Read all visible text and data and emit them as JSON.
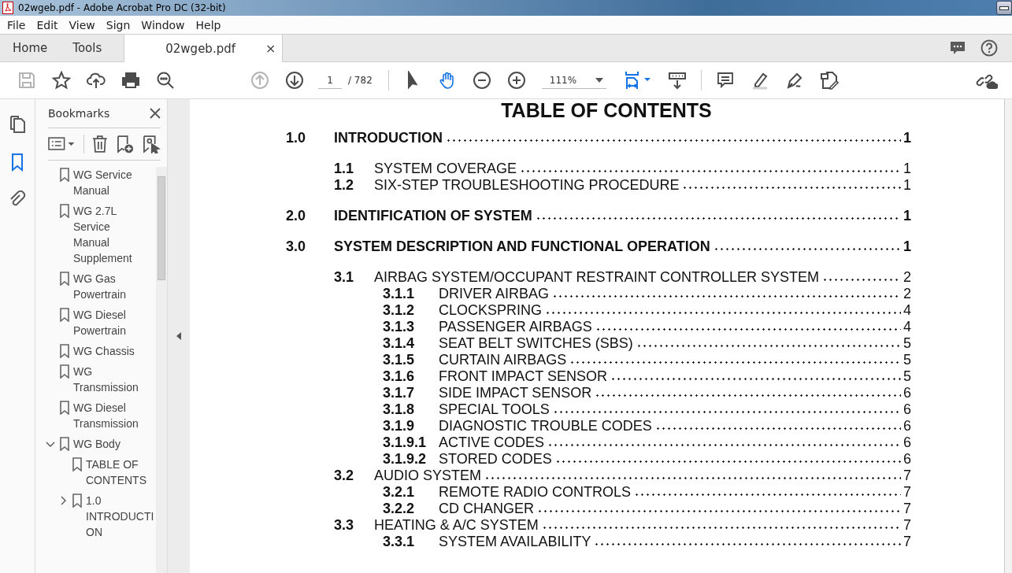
{
  "window": {
    "title": "02wgeb.pdf - Adobe Acrobat Pro DC (32-bit)"
  },
  "menu": [
    "File",
    "Edit",
    "View",
    "Sign",
    "Window",
    "Help"
  ],
  "tabs": [
    {
      "label": "Home",
      "selected": false
    },
    {
      "label": "Tools",
      "selected": false
    },
    {
      "label": "02wgeb.pdf",
      "selected": true,
      "close": "×"
    }
  ],
  "toolbar": {
    "file_tools": [
      {
        "kind": "save",
        "disabled": true,
        "selected": false
      },
      {
        "kind": "star",
        "disabled": false,
        "selected": false
      },
      {
        "kind": "upload",
        "disabled": false,
        "selected": false
      },
      {
        "kind": "print",
        "disabled": false,
        "selected": false
      },
      {
        "kind": "find",
        "disabled": false,
        "selected": false
      }
    ],
    "nav_tools": [
      {
        "kind": "prev",
        "disabled": true,
        "selected": false
      },
      {
        "kind": "next",
        "disabled": false,
        "selected": false
      }
    ],
    "page_number": "1",
    "page_total": "/ 782",
    "view_tools": [
      {
        "kind": "pointer",
        "disabled": false,
        "selected": false
      },
      {
        "kind": "hand",
        "disabled": false,
        "selected": true
      },
      {
        "kind": "zoomout",
        "disabled": false,
        "selected": false
      },
      {
        "kind": "zoomin",
        "disabled": false,
        "selected": false
      }
    ],
    "zoom": "111%",
    "layout_tools": [
      {
        "kind": "fit",
        "disabled": false,
        "selected": true
      },
      {
        "kind": "scroll",
        "disabled": false,
        "selected": false
      }
    ],
    "edit_tools": [
      {
        "kind": "comment",
        "disabled": false,
        "selected": false
      },
      {
        "kind": "highlight",
        "disabled": false,
        "selected": false
      },
      {
        "kind": "sign",
        "disabled": false,
        "selected": false
      },
      {
        "kind": "edit",
        "disabled": false,
        "selected": false
      }
    ]
  },
  "rail": [
    {
      "kind": "pages",
      "selected": false
    },
    {
      "kind": "bookmarks",
      "selected": true
    },
    {
      "kind": "attachments",
      "selected": false
    }
  ],
  "bookmarks": {
    "title": "Bookmarks",
    "items": [
      {
        "label": "WG Service Manual",
        "kind": "leaf"
      },
      {
        "label": "WG 2.7L Service Manual Supplement",
        "kind": "leaf"
      },
      {
        "label": "WG Gas Powertrain",
        "kind": "leaf"
      },
      {
        "label": "WG Diesel Powertrain",
        "kind": "leaf"
      },
      {
        "label": "WG Chassis",
        "kind": "leaf"
      },
      {
        "label": "WG Transmission",
        "kind": "leaf"
      },
      {
        "label": "WG Diesel Transmission",
        "kind": "leaf"
      },
      {
        "label": "WG Body",
        "kind": "folder",
        "expanded": true,
        "children": [
          {
            "label": "TABLE OF CONTENTS",
            "kind": "leaf"
          },
          {
            "label": "1.0 INTRODUCTION",
            "kind": "folder",
            "expanded": false
          }
        ]
      }
    ]
  },
  "document": {
    "title": "TABLE OF CONTENTS",
    "entries": [
      {
        "kind": "chapter",
        "number": "1.0",
        "title": "INTRODUCTION",
        "page": "1"
      },
      {
        "kind": "section",
        "number": "1.1",
        "title": "SYSTEM COVERAGE",
        "page": "1"
      },
      {
        "kind": "section",
        "number": "1.2",
        "title": "SIX-STEP TROUBLESHOOTING PROCEDURE",
        "page": "1"
      },
      {
        "kind": "chapter",
        "number": "2.0",
        "title": "IDENTIFICATION OF SYSTEM",
        "page": "1"
      },
      {
        "kind": "chapter",
        "number": "3.0",
        "title": "SYSTEM DESCRIPTION AND FUNCTIONAL OPERATION",
        "page": "1"
      },
      {
        "kind": "section",
        "number": "3.1",
        "title": "AIRBAG SYSTEM/OCCUPANT RESTRAINT CONTROLLER SYSTEM",
        "page": "2"
      },
      {
        "kind": "subsection",
        "number": "3.1.1",
        "title": "DRIVER AIRBAG",
        "page": "2"
      },
      {
        "kind": "subsection",
        "number": "3.1.2",
        "title": "CLOCKSPRING",
        "page": "4"
      },
      {
        "kind": "subsection",
        "number": "3.1.3",
        "title": "PASSENGER AIRBAGS",
        "page": "4"
      },
      {
        "kind": "subsection",
        "number": "3.1.4",
        "title": "SEAT BELT SWITCHES (SBS)",
        "page": "5"
      },
      {
        "kind": "subsection",
        "number": "3.1.5",
        "title": "CURTAIN AIRBAGS",
        "page": "5"
      },
      {
        "kind": "subsection",
        "number": "3.1.6",
        "title": "FRONT IMPACT SENSOR",
        "page": "5"
      },
      {
        "kind": "subsection",
        "number": "3.1.7",
        "title": "SIDE IMPACT SENSOR",
        "page": "6"
      },
      {
        "kind": "subsection",
        "number": "3.1.8",
        "title": "SPECIAL TOOLS",
        "page": "6"
      },
      {
        "kind": "subsection",
        "number": "3.1.9",
        "title": "DIAGNOSTIC TROUBLE CODES",
        "page": "6"
      },
      {
        "kind": "subsection",
        "number": "3.1.9.1",
        "title": "ACTIVE CODES",
        "page": "6"
      },
      {
        "kind": "subsection",
        "number": "3.1.9.2",
        "title": "STORED CODES",
        "page": "6"
      },
      {
        "kind": "section",
        "number": "3.2",
        "title": "AUDIO SYSTEM",
        "page": "7"
      },
      {
        "kind": "subsection",
        "number": "3.2.1",
        "title": "REMOTE RADIO CONTROLS",
        "page": "7"
      },
      {
        "kind": "subsection",
        "number": "3.2.2",
        "title": "CD CHANGER",
        "page": "7"
      },
      {
        "kind": "section",
        "number": "3.3",
        "title": "HEATING & A/C SYSTEM",
        "page": "7"
      },
      {
        "kind": "subsection",
        "number": "3.3.1",
        "title": "SYSTEM AVAILABILITY",
        "page": "7"
      }
    ]
  }
}
